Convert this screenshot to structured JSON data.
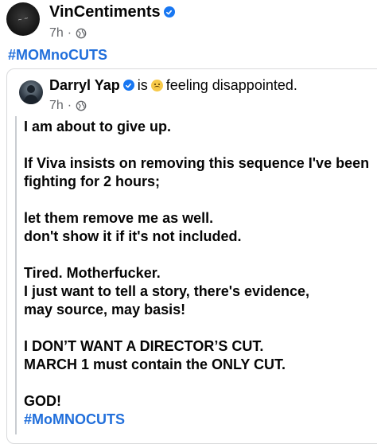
{
  "post": {
    "author": "VinCentiments",
    "time": "7h",
    "dot": "·",
    "verified": true,
    "privacy_icon": "globe-icon",
    "hashtag": "#MOMnoCUTS"
  },
  "shared_post": {
    "author": "Darryl Yap",
    "is_text": "is",
    "feeling_emoji": "disappointed-face-icon",
    "feeling_text": "feeling disappointed.",
    "time": "7h",
    "dot": "·",
    "lines": [
      "I am about to give up.",
      "",
      "If Viva insists on removing this sequence I've been",
      "fighting for 2 hours;",
      "",
      "let them remove me as well.",
      "don't show it if it's not included.",
      "",
      "Tired. Motherfucker.",
      "I just want to tell a story, there's evidence,",
      "may source, may basis!",
      "",
      "I DON’T WANT A DIRECTOR’S CUT.",
      "MARCH 1 must contain the ONLY CUT.",
      "",
      "GOD!"
    ],
    "hashtag": "#MoMNOCUTS"
  },
  "colors": {
    "link": "#216fdb",
    "verified": "#1877f2",
    "meta": "#65676b"
  }
}
